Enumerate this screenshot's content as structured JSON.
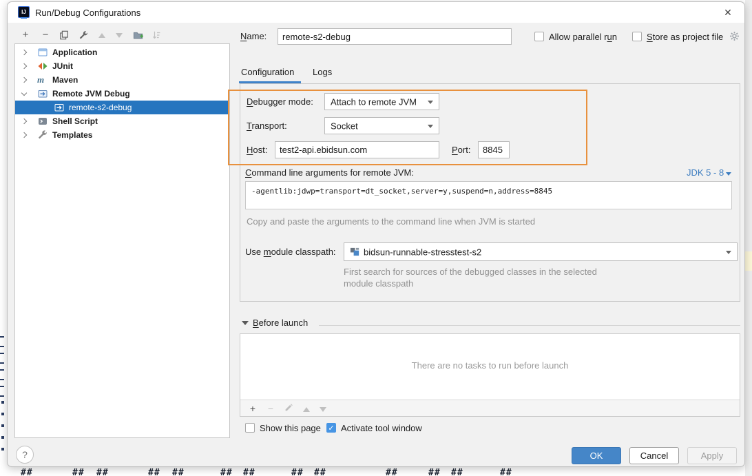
{
  "window": {
    "title": "Run/Debug Configurations"
  },
  "icons": {
    "close": "✕",
    "plus": "+",
    "minus": "−",
    "check": "✓",
    "help": "?"
  },
  "toolbar": {
    "add": "add-configuration",
    "remove": "remove-configuration",
    "copy": "copy-configuration",
    "edit_templates": "edit-templates",
    "move_up": "move-up",
    "move_down": "move-down",
    "new_folder": "create-new-folder",
    "sort": "sort-configurations"
  },
  "tree": {
    "items": [
      {
        "label": "Application",
        "type": "application",
        "level": 0,
        "state": "collapsed"
      },
      {
        "label": "JUnit",
        "type": "junit",
        "level": 0,
        "state": "collapsed"
      },
      {
        "label": "Maven",
        "type": "maven",
        "level": 0,
        "state": "collapsed"
      },
      {
        "label": "Remote JVM Debug",
        "type": "remote",
        "level": 0,
        "state": "expanded"
      },
      {
        "label": "remote-s2-debug",
        "type": "remote",
        "level": 1,
        "selected": true
      },
      {
        "label": "Shell Script",
        "type": "shell",
        "level": 0,
        "state": "collapsed"
      },
      {
        "label": "Templates",
        "type": "templates",
        "level": 0,
        "state": "collapsed"
      }
    ],
    "maven_glyph": "m",
    "shell_glyph": "›"
  },
  "form": {
    "name_label": {
      "text": "Name:",
      "u": 0
    },
    "name_value": "remote-s2-debug",
    "allow_parallel": {
      "text": "Allow parallel run",
      "u": 16
    },
    "store_project": {
      "text": "Store as project file",
      "u": 0
    },
    "tabs": [
      {
        "label": "Configuration",
        "active": true
      },
      {
        "label": "Logs",
        "active": false
      }
    ],
    "debugger_mode_label": {
      "text": "Debugger mode:",
      "u": 0
    },
    "debugger_mode_value": "Attach to remote JVM",
    "transport_label": {
      "text": "Transport:",
      "u": 0
    },
    "transport_value": "Socket",
    "host_label": {
      "text": "Host:",
      "u": 0
    },
    "host_value": "test2-api.ebidsun.com",
    "port_label": {
      "text": "Port:",
      "u": 0
    },
    "port_value": "8845",
    "cmdline_label": {
      "text": "Command line arguments for remote JVM:",
      "u": 0
    },
    "jdk_link": "JDK 5 - 8",
    "args_value": "-agentlib:jdwp=transport=dt_socket,server=y,suspend=n,address=8845",
    "args_hint": "Copy and paste the arguments to the command line when JVM is started",
    "module_label": {
      "text": "Use module classpath:",
      "u": 4
    },
    "module_value": "bidsun-runnable-stresstest-s2",
    "module_hint_line1": "First search for sources of the debugged classes in the selected",
    "module_hint_line2": "module classpath",
    "before_launch_label": {
      "text": "Before launch",
      "u": 0
    },
    "tasks_empty_text": "There are no tasks to run before launch",
    "show_this_page": "Show this page",
    "activate_tool_window": "Activate tool window"
  },
  "buttons": {
    "ok": "OK",
    "cancel": "Cancel",
    "apply": "Apply"
  },
  "colors": {
    "selection_blue": "#2675bf",
    "tab_accent": "#4083c9",
    "ok_blue": "#4586c8",
    "checkbox_blue": "#4795e4",
    "highlight_orange": "#e8913e",
    "link_blue": "#3d7dc0"
  },
  "bg": {
    "hash": "##"
  }
}
